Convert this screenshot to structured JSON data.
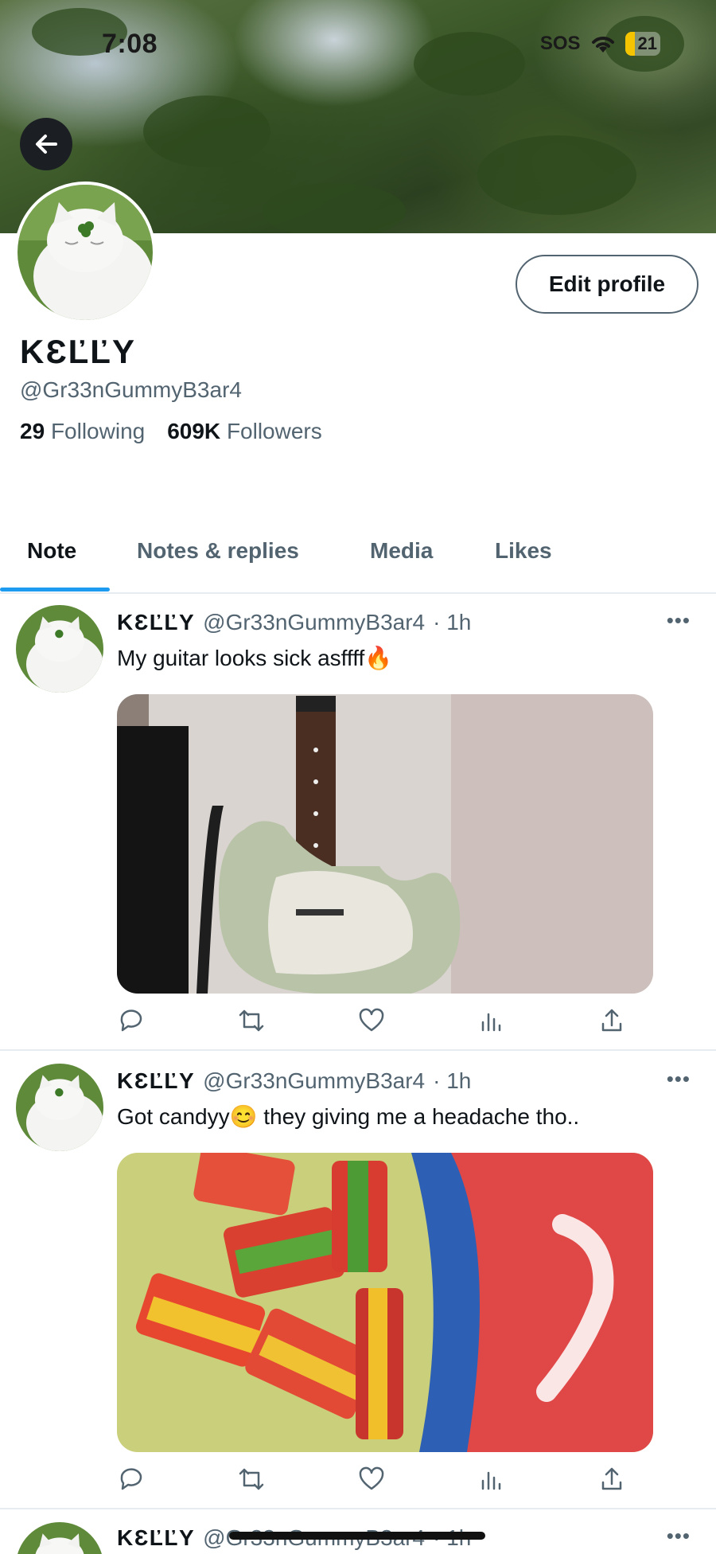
{
  "status_bar": {
    "time": "7:08",
    "sos": "SOS",
    "battery": "21"
  },
  "profile": {
    "display_name": "KƐĽĽY",
    "handle": "@Gr33nGummyB3ar4",
    "following_count": "29",
    "following_label": "Following",
    "followers_count": "609K",
    "followers_label": "Followers",
    "edit_button": "Edit profile"
  },
  "tabs": [
    {
      "label": "Note",
      "active": true
    },
    {
      "label": "Notes & replies"
    },
    {
      "label": "Media"
    },
    {
      "label": "Likes"
    }
  ],
  "posts": [
    {
      "name": "KƐĽĽY",
      "handle": "@Gr33nGummyB3ar4",
      "time": "· 1h",
      "text": "My guitar looks sick asffff🔥",
      "media": "guitar-photo"
    },
    {
      "name": "KƐĽĽY",
      "handle": "@Gr33nGummyB3ar4",
      "time": "· 1h",
      "text": "Got candyy😊  they giving me a headache tho..",
      "media": "candy-photo"
    },
    {
      "name": "KƐĽĽY",
      "handle": "@Gr33nGummyB3ar4",
      "time": "· 1h",
      "text": ""
    }
  ],
  "icons": {
    "back": "arrow-left-icon",
    "reply": "reply-icon",
    "repost": "repost-icon",
    "like": "heart-icon",
    "views": "views-icon",
    "share": "share-icon",
    "more": "more-icon"
  },
  "colors": {
    "accent": "#1d9bf0",
    "muted": "#536471",
    "text": "#0f1419"
  }
}
